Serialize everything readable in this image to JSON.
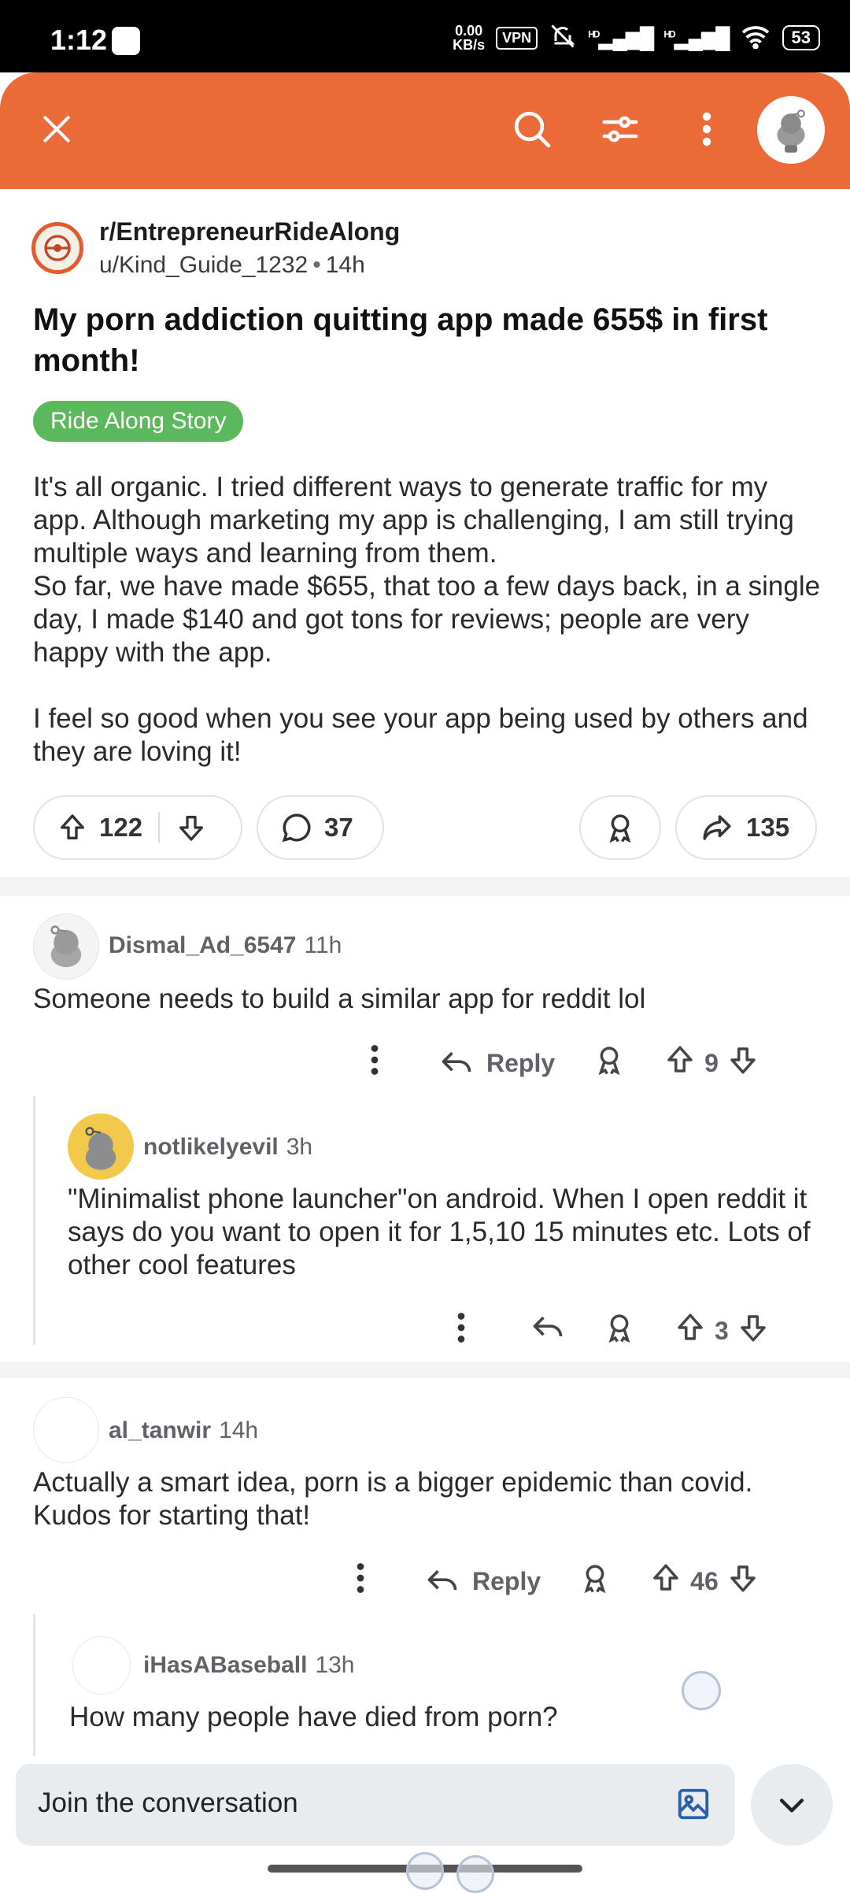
{
  "status_bar": {
    "time": "1:12",
    "net_speed": "0.00",
    "net_unit": "KB/s",
    "vpn": "VPN",
    "signal1": "HD",
    "signal2": "HD",
    "battery": "53"
  },
  "top_bar": {
    "close_icon": "close-icon",
    "search_icon": "search-icon",
    "filter_icon": "sort-filter-icon",
    "more_icon": "more-vertical-icon",
    "avatar_icon": "snoo-avatar-icon"
  },
  "post": {
    "subreddit": "r/EntrepreneurRideAlong",
    "author": "u/Kind_Guide_1232",
    "age": "14h",
    "title": "My porn addiction quitting app made 655$ in first month!",
    "flair": "Ride Along Story",
    "body": "It's all organic. I tried different ways to generate traffic for my app. Although marketing my app is challenging, I am still trying multiple ways and learning from them.\nSo far, we have made $655, that too a few days back, in a single day, I made $140 and got tons for reviews; people are very happy with the app.\n\nI feel so good when you see your app being used by others and they are loving it!",
    "upvotes": "122",
    "comments": "37",
    "shares": "135"
  },
  "comments": [
    {
      "user": "Dismal_Ad_6547",
      "age": "11h",
      "text": "Someone needs to build a similar app for reddit lol",
      "reply_label": "Reply",
      "votes": "9"
    },
    {
      "user": "notlikelyevil",
      "age": "3h",
      "text": "\"Minimalist phone launcher\"on android. When I open reddit it says do you want to open it for 1,5,10 15 minutes etc. Lots of other cool features",
      "votes": "3"
    },
    {
      "user": "al_tanwir",
      "age": "14h",
      "text": "Actually a smart idea, porn is a bigger epidemic than covid. Kudos for starting that!",
      "reply_label": "Reply",
      "votes": "46"
    },
    {
      "user": "iHasABaseball",
      "age": "13h",
      "text": "How many people have died from porn?"
    }
  ],
  "composer": {
    "placeholder": "Join the conversation"
  },
  "colors": {
    "header": "#ea6b38",
    "flair": "#5cb85c"
  }
}
